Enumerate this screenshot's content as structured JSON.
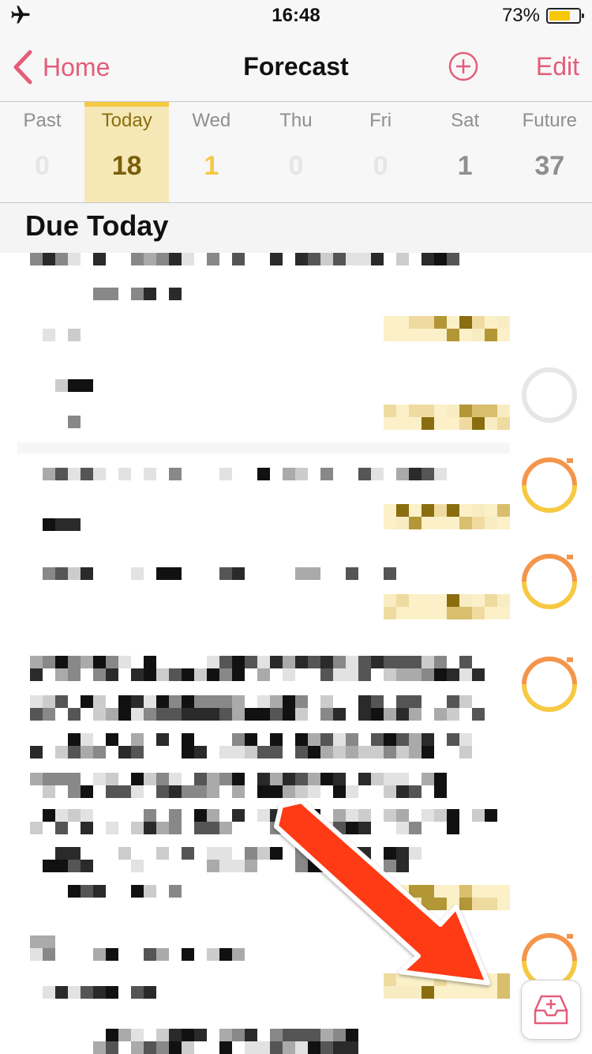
{
  "status_bar": {
    "time": "16:48",
    "battery_percent": "73%",
    "battery_level": 0.73,
    "icons": [
      "airplane-icon",
      "battery-icon"
    ]
  },
  "nav": {
    "back_label": "Home",
    "title": "Forecast",
    "edit_label": "Edit",
    "icons": [
      "chevron-left-icon",
      "add-circle-icon"
    ]
  },
  "days": [
    {
      "name": "Past",
      "count": "0"
    },
    {
      "name": "Today",
      "count": "18"
    },
    {
      "name": "Wed",
      "count": "1"
    },
    {
      "name": "Thu",
      "count": "0"
    },
    {
      "name": "Fri",
      "count": "0"
    },
    {
      "name": "Sat",
      "count": "1"
    },
    {
      "name": "Future",
      "count": "37"
    }
  ],
  "section": {
    "title": "Due Today"
  },
  "colors": {
    "accent": "#e35d7a",
    "today_highlight": "#f6e8b6",
    "today_bar": "#f6c943",
    "ring_orange": "#f4954c",
    "ring_yellow": "#f6c943",
    "arrow": "#ff3b14"
  },
  "quick_entry": {
    "icon": "inbox-add-icon"
  }
}
